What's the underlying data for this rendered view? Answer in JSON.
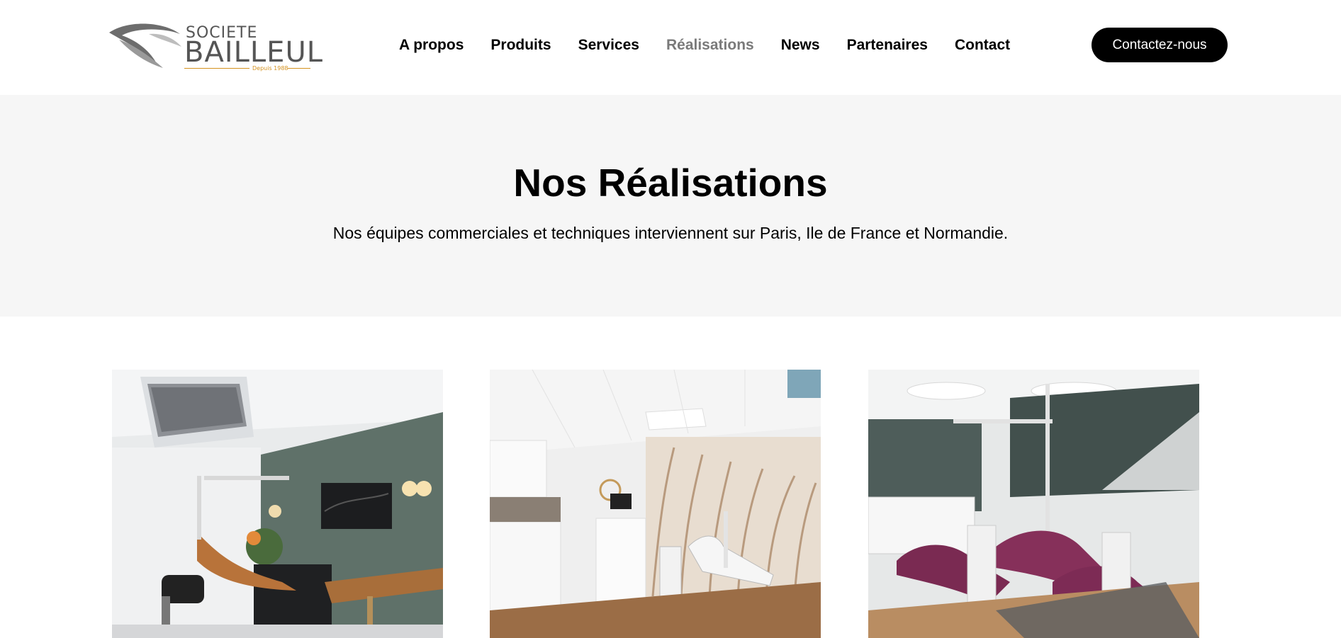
{
  "header": {
    "logo": {
      "top": "SOCIETE",
      "main": "BAILLEUL",
      "since": "Depuis 1988"
    },
    "nav": [
      {
        "label": "A propos",
        "active": false
      },
      {
        "label": "Produits",
        "active": false
      },
      {
        "label": "Services",
        "active": false
      },
      {
        "label": "Réalisations",
        "active": true
      },
      {
        "label": "News",
        "active": false
      },
      {
        "label": "Partenaires",
        "active": false
      },
      {
        "label": "Contact",
        "active": false
      }
    ],
    "cta_label": "Contactez-nous"
  },
  "hero": {
    "title": "Nos Réalisations",
    "subtitle": "Nos équipes commerciales et techniques interviennent sur Paris, Ile de France et Normandie."
  },
  "gallery": [
    {
      "name": "dental-office-green-wall"
    },
    {
      "name": "dental-office-wheat-mural"
    },
    {
      "name": "dental-office-purple-chairs"
    }
  ],
  "colors": {
    "accent": "#000000",
    "active_nav": "#7a7a7a",
    "hero_bg": "#f6f6f6",
    "logo_gold": "#d4911e"
  }
}
